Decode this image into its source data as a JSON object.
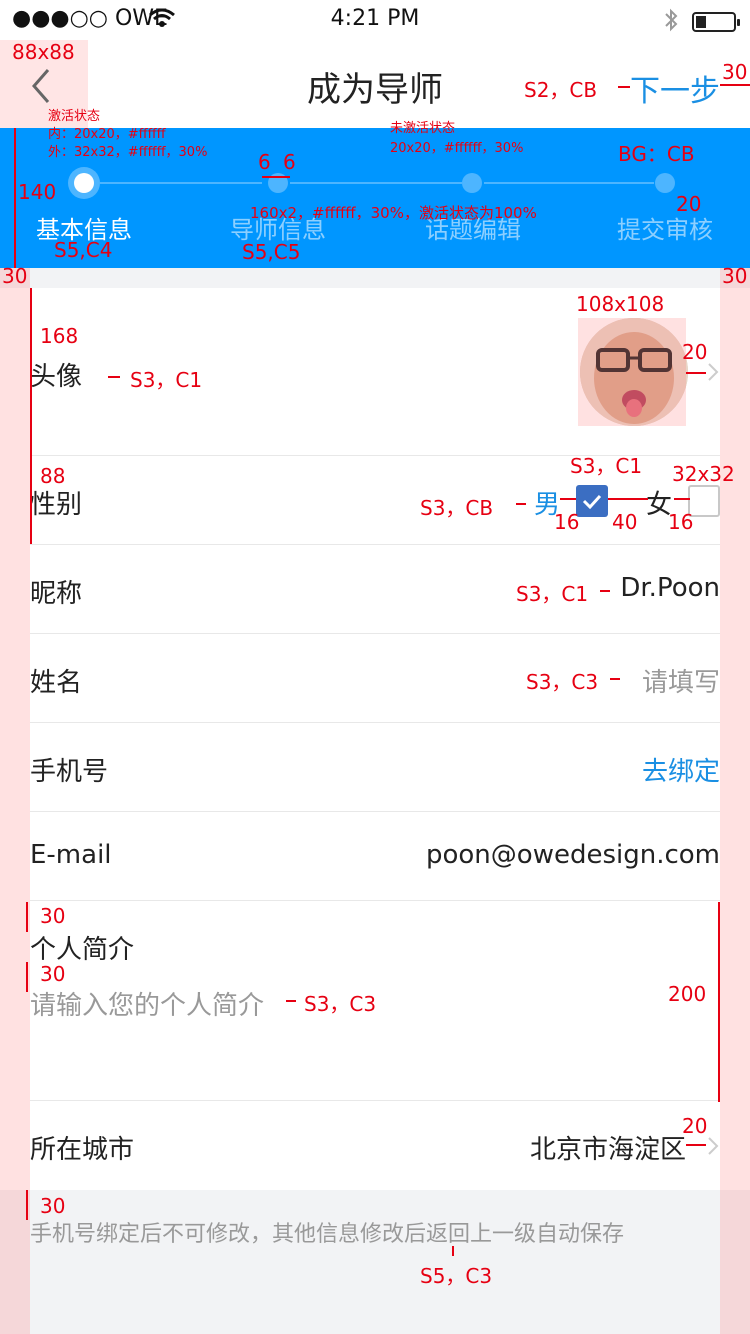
{
  "statusbar": {
    "carrier": "●●●○○ OWE",
    "time": "4:21 PM"
  },
  "nav": {
    "title": "成为导师",
    "next_label": "下一步",
    "back_icon": "chevron-left-icon"
  },
  "steps": [
    {
      "label": "基本信息",
      "state": "active"
    },
    {
      "label": "导师信息",
      "state": "inactive"
    },
    {
      "label": "话题编辑",
      "state": "inactive"
    },
    {
      "label": "提交审核",
      "state": "inactive"
    }
  ],
  "colors": {
    "accent": "#0096ff",
    "link": "#1a8fe3",
    "check": "#3b6ec2",
    "annotation": "#e60012"
  },
  "form": {
    "avatar": {
      "label": "头像"
    },
    "gender": {
      "label": "性别",
      "male": "男",
      "female": "女",
      "selected": "男"
    },
    "nickname": {
      "label": "昵称",
      "value": "Dr.Poon"
    },
    "name": {
      "label": "姓名",
      "placeholder": "请填写"
    },
    "phone": {
      "label": "手机号",
      "action": "去绑定"
    },
    "email": {
      "label": "E-mail",
      "value": "poon@owedesign.com"
    },
    "bio": {
      "label": "个人简介",
      "placeholder": "请输入您的个人简介"
    },
    "city": {
      "label": "所在城市",
      "value": "北京市海淀区"
    }
  },
  "footnote": "手机号绑定后不可修改，其他信息修改后返回上一级自动保存",
  "annotations": {
    "back_size": "88x88",
    "right_margin": "30",
    "title_spec": "S2，CB",
    "active_state_title": "激活状态",
    "active_state_inner": "内：20x20，#ffffff",
    "active_state_outer": "外：32x32，#ffffff，30%",
    "inactive_state_title": "未激活状态",
    "inactive_state_dot": "20x20，#ffffff，30%",
    "bg": "BG：CB",
    "gap_a": "6",
    "gap_b": "6",
    "line_spec": "160x2，#ffffff，30%，激活状态为100%",
    "steps_height": "140",
    "step_bottom": "20",
    "step1_spec": "S5,C4",
    "step2_spec": "S5,C5",
    "left_margin": "30",
    "right_margin2": "30",
    "avatar_size": "108x108",
    "row168": "168",
    "avatar_label_spec": "S3，C1",
    "chev_gap": "20",
    "row88": "88",
    "gender_value_spec": "S3，C1",
    "check_size": "32x32",
    "gender_male_spec": "S3，CB",
    "gap16a": "16",
    "gap40": "40",
    "gap16b": "16",
    "nickname_spec": "S3，C1",
    "name_spec": "S3，C3",
    "bio_top": "30",
    "bio_mid": "30",
    "bio_spec": "S3，C3",
    "bio_height": "200",
    "city_gap": "20",
    "foot_top": "30",
    "foot_spec": "S5，C3"
  }
}
